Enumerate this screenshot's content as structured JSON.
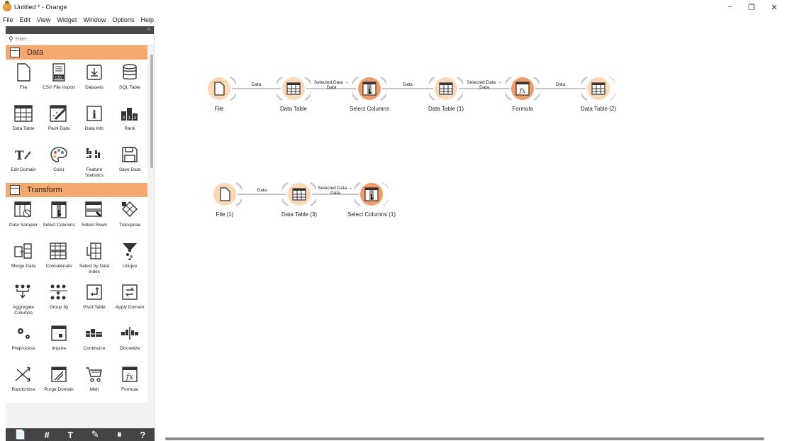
{
  "window": {
    "title": "Untitled * - Orange",
    "controls": {
      "minimize": "−",
      "restore": "❐",
      "close": "✕"
    }
  },
  "menu": [
    {
      "label": "File",
      "u": "F",
      "rest": "ile"
    },
    {
      "label": "Edit",
      "u": "E",
      "rest": "dit"
    },
    {
      "label": "View",
      "u": "V",
      "rest": "iew"
    },
    {
      "label": "Widget",
      "u": "W",
      "rest": "idget"
    },
    {
      "label": "Window",
      "u": "",
      "rest": "Window"
    },
    {
      "label": "Options",
      "u": "O",
      "rest": "ptions"
    },
    {
      "label": "Help",
      "u": "H",
      "rest": "elp"
    }
  ],
  "sidebar": {
    "filter_placeholder": "Filter...",
    "collapse_glyph": "«",
    "categories": [
      {
        "name": "Data",
        "widgets": [
          {
            "label": "File",
            "icon": "file-icon"
          },
          {
            "label": "CSV File Import",
            "icon": "csv-icon"
          },
          {
            "label": "Datasets",
            "icon": "datasets-icon"
          },
          {
            "label": "SQL Table",
            "icon": "database-icon"
          },
          {
            "label": "Data Table",
            "icon": "table-icon"
          },
          {
            "label": "Paint Data",
            "icon": "paint-icon"
          },
          {
            "label": "Data Info",
            "icon": "info-icon"
          },
          {
            "label": "Rank",
            "icon": "rank-icon"
          },
          {
            "label": "Edit Domain",
            "icon": "edit-domain-icon"
          },
          {
            "label": "Color",
            "icon": "palette-icon"
          },
          {
            "label": "Feature Statistics",
            "icon": "feature-stats-icon"
          },
          {
            "label": "Save Data",
            "icon": "save-icon"
          }
        ]
      },
      {
        "name": "Transform",
        "widgets": [
          {
            "label": "Data Sampler",
            "icon": "sampler-icon"
          },
          {
            "label": "Select Columns",
            "icon": "select-columns-icon"
          },
          {
            "label": "Select Rows",
            "icon": "select-rows-icon"
          },
          {
            "label": "Transpose",
            "icon": "transpose-icon"
          },
          {
            "label": "Merge Data",
            "icon": "merge-icon"
          },
          {
            "label": "Concatenate",
            "icon": "concatenate-icon"
          },
          {
            "label": "Select by Data Index",
            "icon": "select-index-icon"
          },
          {
            "label": "Unique",
            "icon": "funnel-icon"
          },
          {
            "label": "Aggregate Columns",
            "icon": "aggregate-icon"
          },
          {
            "label": "Group by",
            "icon": "group-by-icon"
          },
          {
            "label": "Pivot Table",
            "icon": "pivot-icon"
          },
          {
            "label": "Apply Domain",
            "icon": "apply-domain-icon"
          },
          {
            "label": "Preprocess",
            "icon": "gears-icon"
          },
          {
            "label": "Impute",
            "icon": "impute-icon"
          },
          {
            "label": "Continuize",
            "icon": "continuize-icon"
          },
          {
            "label": "Discretize",
            "icon": "discretize-icon"
          },
          {
            "label": "Randomize",
            "icon": "randomize-icon"
          },
          {
            "label": "Purge Domain",
            "icon": "purge-icon"
          },
          {
            "label": "Melt",
            "icon": "cart-icon"
          },
          {
            "label": "Formula",
            "icon": "formula-icon"
          }
        ]
      }
    ],
    "bottom_tools": [
      "📄",
      "#",
      "T",
      "✎",
      "⏸",
      "?"
    ]
  },
  "workflow": {
    "nodes": [
      {
        "id": "n1",
        "label": "File",
        "kind": "file"
      },
      {
        "id": "n2",
        "label": "Data Table",
        "kind": "table"
      },
      {
        "id": "n3",
        "label": "Select Columns",
        "kind": "select"
      },
      {
        "id": "n4",
        "label": "Data Table (1)",
        "kind": "table"
      },
      {
        "id": "n5",
        "label": "Formula",
        "kind": "formula"
      },
      {
        "id": "n6",
        "label": "Data Table (2)",
        "kind": "table"
      },
      {
        "id": "n7",
        "label": "File (1)",
        "kind": "file"
      },
      {
        "id": "n8",
        "label": "Data Table (3)",
        "kind": "table"
      },
      {
        "id": "n9",
        "label": "Select Columns (1)",
        "kind": "select"
      }
    ],
    "links": [
      {
        "label1": "Data",
        "label2": ""
      },
      {
        "label1": "Selected Data →",
        "label2": "Data"
      },
      {
        "label1": "Data",
        "label2": ""
      },
      {
        "label1": "Selected Data →",
        "label2": "Data"
      },
      {
        "label1": "Data",
        "label2": ""
      },
      {
        "label1": "Data",
        "label2": ""
      },
      {
        "label1": "Selected Data →",
        "label2": "Data"
      }
    ]
  },
  "colors": {
    "accent": "#f5a96c",
    "node_bg": "#fcd9b4",
    "node_active": "#f39b63",
    "dark": "#444444"
  }
}
